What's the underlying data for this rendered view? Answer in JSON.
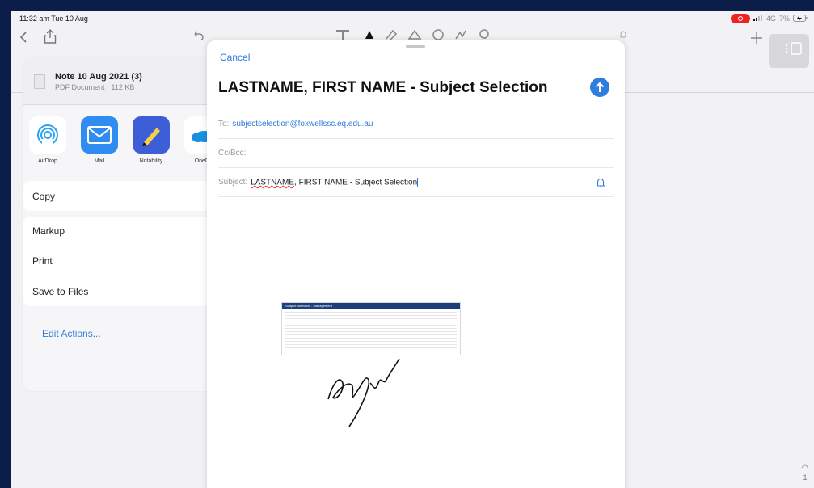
{
  "status": {
    "time": "11:32 am  Tue 10 Aug",
    "network": "4G",
    "battery": "7%"
  },
  "sheet": {
    "doc_title": "Note 10 Aug 2021 (3)",
    "doc_subtitle": "PDF Document · 112 KB",
    "apps": [
      {
        "label": "AirDrop",
        "icon": "airdrop-icon"
      },
      {
        "label": "Mail",
        "icon": "mail-icon"
      },
      {
        "label": "Notability",
        "icon": "notability-icon"
      },
      {
        "label": "OneDr",
        "icon": "onedrive-icon"
      }
    ],
    "group1": [
      "Copy"
    ],
    "group2": [
      "Markup",
      "Print",
      "Save to Files"
    ],
    "edit_actions": "Edit Actions..."
  },
  "compose": {
    "cancel": "Cancel",
    "title": "LASTNAME, FIRST NAME - Subject Selection",
    "to_label": "To:",
    "to_value": "subjectselection@foxwellssc.eq.edu.au",
    "cc_label": "Cc/Bcc:",
    "subject_label": "Subject:",
    "subject_misspelled": "LASTNAME",
    "subject_rest": ", FIRST NAME - Subject Selection",
    "attachment_header": "Subject Selection - Management"
  },
  "colors": {
    "accent": "#2f7ddc",
    "frame": "#0c1d4a",
    "recording": "#e22222"
  },
  "scroll": {
    "page": "1"
  }
}
